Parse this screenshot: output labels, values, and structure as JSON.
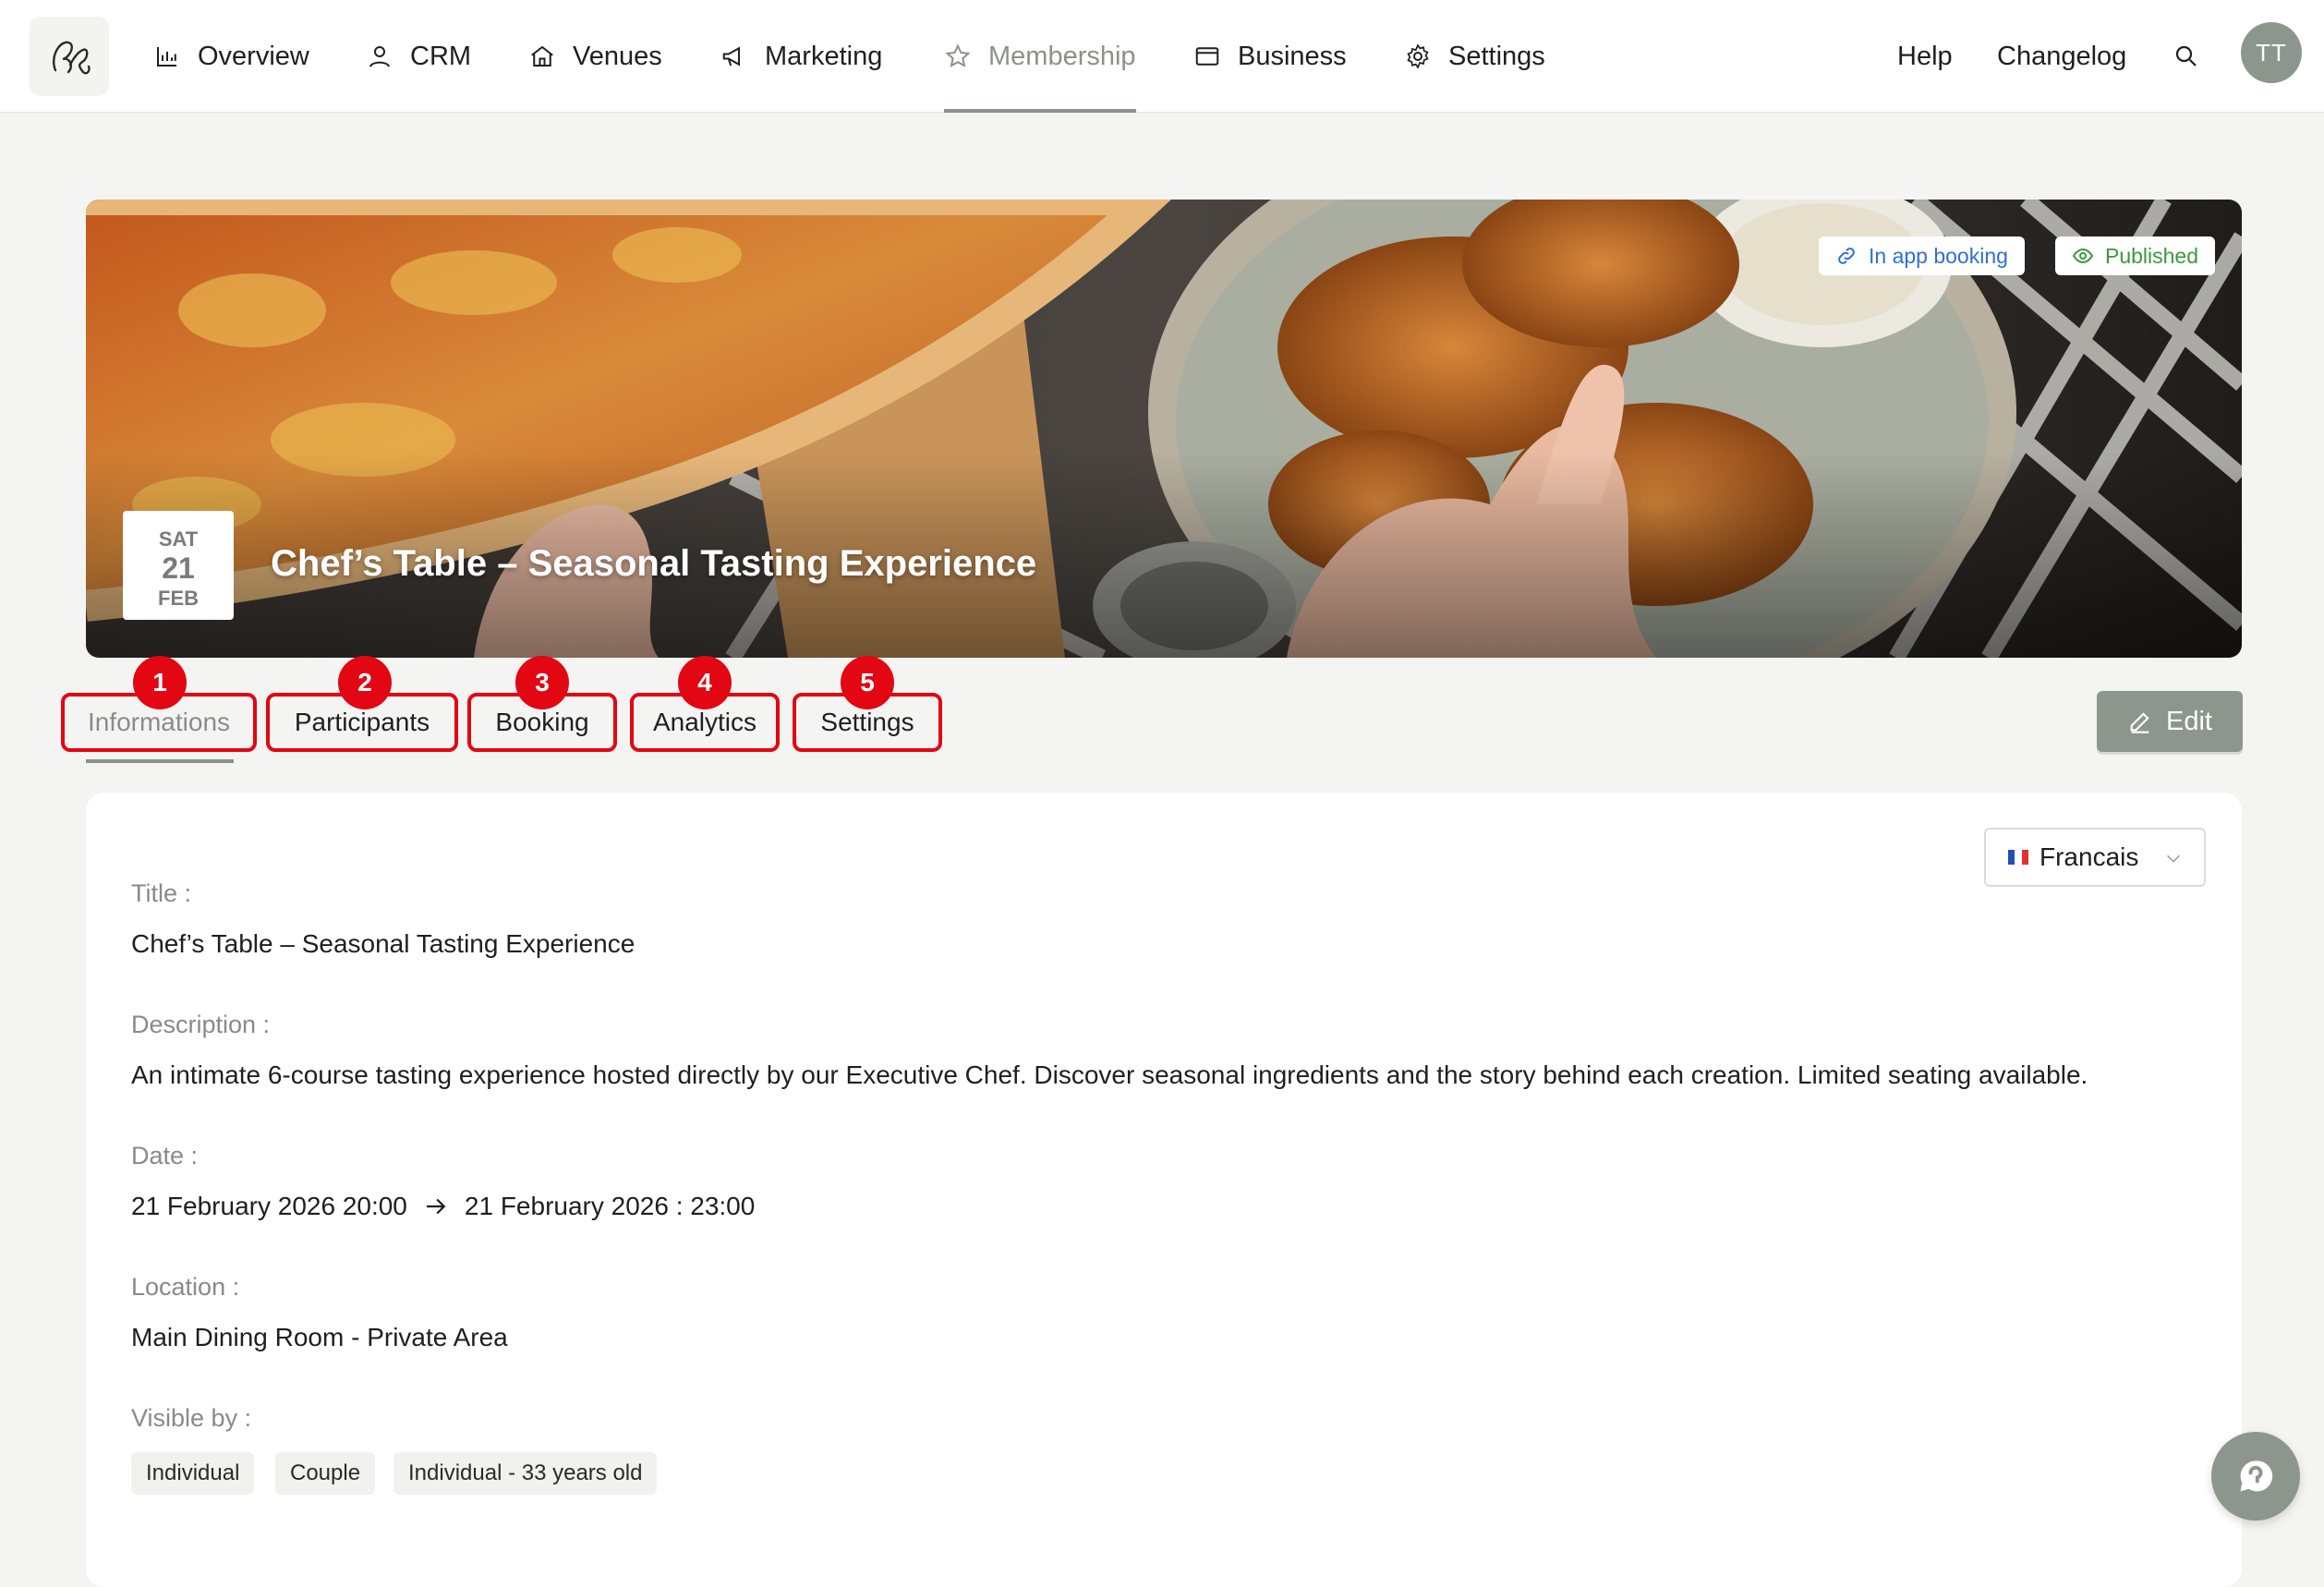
{
  "nav": {
    "items": [
      {
        "label": "Overview",
        "icon": "chart-icon"
      },
      {
        "label": "CRM",
        "icon": "user-icon"
      },
      {
        "label": "Venues",
        "icon": "home-icon"
      },
      {
        "label": "Marketing",
        "icon": "megaphone-icon"
      },
      {
        "label": "Membership",
        "icon": "star-icon",
        "active": true
      },
      {
        "label": "Business",
        "icon": "wallet-icon"
      },
      {
        "label": "Settings",
        "icon": "gear-icon"
      }
    ],
    "help_label": "Help",
    "changelog_label": "Changelog",
    "avatar_initials": "TT"
  },
  "event": {
    "badges": {
      "booking": "In app booking",
      "published": "Published"
    },
    "date_card": {
      "weekday": "SAT",
      "day": "21",
      "month": "FEB"
    },
    "title": "Chef’s Table – Seasonal Tasting Experience"
  },
  "tabs": [
    {
      "label": "Informations",
      "marker": "1",
      "active": true
    },
    {
      "label": "Participants",
      "marker": "2"
    },
    {
      "label": "Booking",
      "marker": "3"
    },
    {
      "label": "Analytics",
      "marker": "4"
    },
    {
      "label": "Settings",
      "marker": "5"
    }
  ],
  "edit_label": "Edit",
  "language": {
    "selected": "Francais"
  },
  "details": {
    "title_label": "Title :",
    "title_value": "Chef’s Table – Seasonal Tasting Experience",
    "description_label": "Description :",
    "description_value": "An intimate 6-course tasting experience hosted directly by our Executive Chef. Discover seasonal ingredients and the story behind each creation. Limited seating available.",
    "date_label": "Date :",
    "date_start": "21 February 2026 20:00",
    "date_end": "21 February 2026 : 23:00",
    "location_label": "Location :",
    "location_value": "Main Dining Room - Private Area",
    "visible_label": "Visible by :",
    "visible_chips": [
      "Individual",
      "Couple",
      "Individual - 33 years old"
    ]
  },
  "colors": {
    "accent": "#8d968c",
    "annotation_red": "#e30613",
    "booking_blue": "#2f6fd6",
    "published_green": "#3a9a3a"
  }
}
